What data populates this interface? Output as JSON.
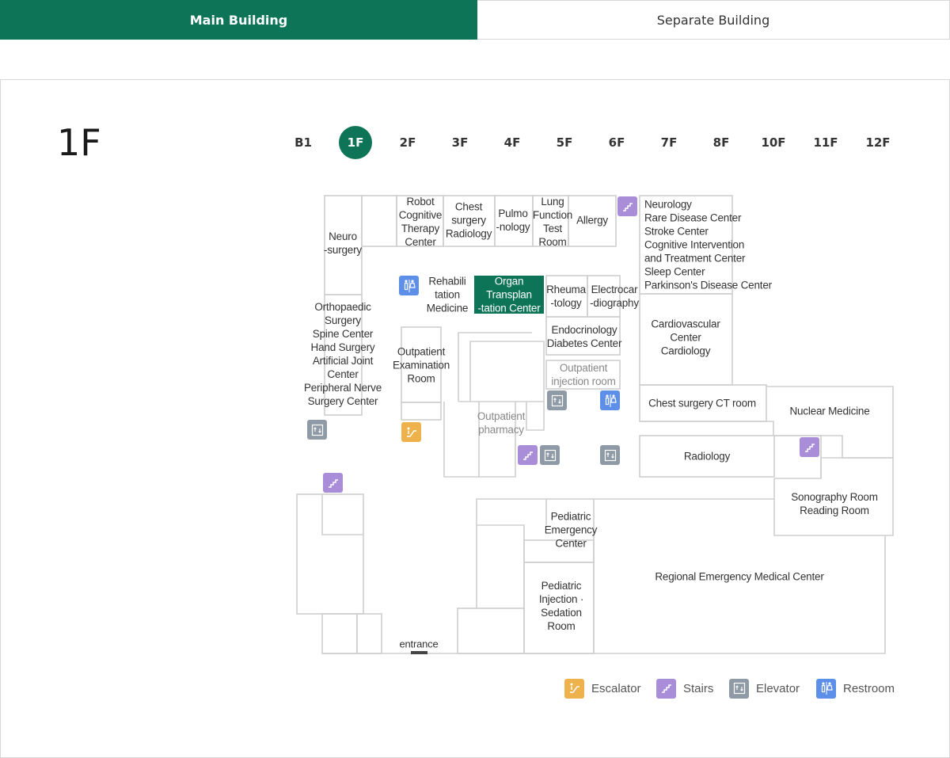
{
  "tabs": {
    "main": "Main Building",
    "separate": "Separate Building"
  },
  "floor": {
    "current": "1F",
    "list": [
      "B1",
      "1F",
      "2F",
      "3F",
      "4F",
      "5F",
      "6F",
      "7F",
      "8F",
      "10F",
      "11F",
      "12F"
    ]
  },
  "rooms": {
    "neurosurgery": "Neuro\n-surgery",
    "robot": "Robot\nCognitive\nTherapy\nCenter",
    "chest_radiology": "Chest\nsurgery\nRadiology",
    "pulmonology": "Pulmo\n-nology",
    "lung_function": "Lung\nFunction\nTest\nRoom",
    "allergy": "Allergy",
    "neurology": "Neurology\nRare Disease Center\nStroke Center\nCognitive Intervention\nand Treatment Center\nSleep Center\nParkinson's Disease Center",
    "orthopaedic": "Orthopaedic\nSurgery\nSpine Center\nHand Surgery\nArtificial Joint\nCenter\nPeripheral Nerve\nSurgery Center",
    "rehabilitation": "Rehabili\ntation\nMedicine",
    "organ_transplant": "Organ\nTransplan\n-tation Center",
    "rheumatology": "Rheuma\n-tology",
    "electrocardiography": "Electrocar\n-diography",
    "endocrinology": "Endocrinology\nDiabetes Center",
    "outpatient_injection": "Outpatient\ninjection room",
    "cardiovascular": "Cardiovascular\nCenter\nCardiology",
    "outpatient_exam": "Outpatient\nExamination\nRoom",
    "outpatient_pharmacy": "Outpatient\npharmacy",
    "chest_ct": "Chest surgery CT room",
    "nuclear_medicine": "Nuclear Medicine",
    "radiology": "Radiology",
    "sonography": "Sonography Room\nReading Room",
    "pediatric_emergency": "Pediatric\nEmergency\nCenter",
    "pediatric_injection": "Pediatric\nInjection ·\nSedation\nRoom",
    "regional_emergency": "Regional Emergency Medical Center",
    "entrance": "entrance"
  },
  "legend": {
    "escalator": "Escalator",
    "stairs": "Stairs",
    "elevator": "Elevator",
    "restroom": "Restroom"
  },
  "colors": {
    "accent": "#0e7458",
    "stairs": "#a98dd9",
    "elevator": "#8e9aa5",
    "restroom": "#5d8ee8",
    "escalator": "#eeb24d",
    "wall": "#cfcfcf"
  }
}
